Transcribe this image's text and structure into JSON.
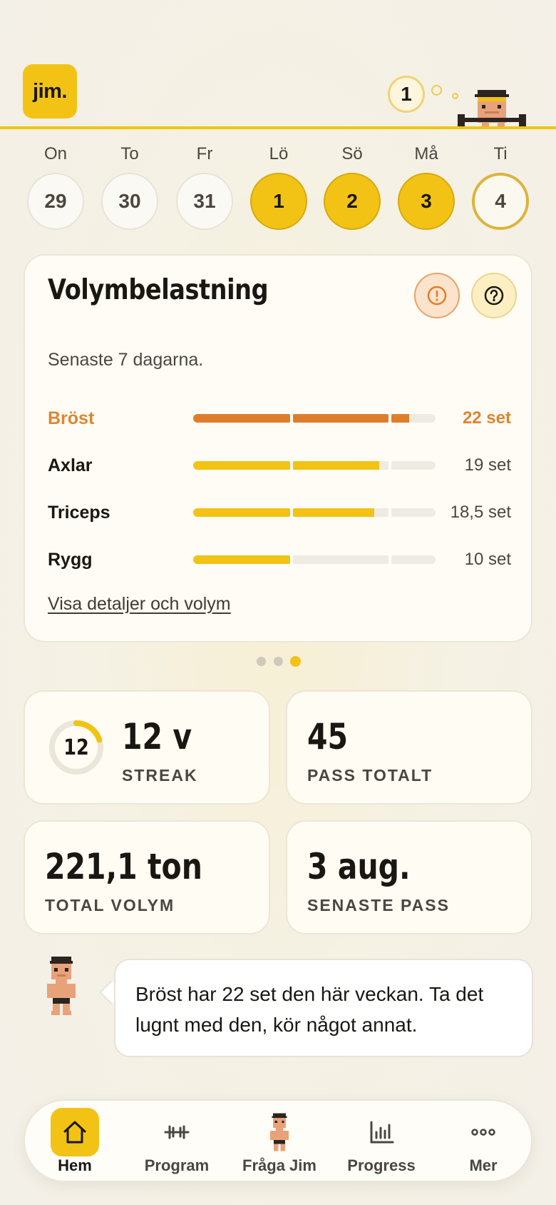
{
  "header": {
    "logo_text": "jim.",
    "notification_count": "1",
    "accent_color": "#f2c314"
  },
  "week": [
    {
      "name": "On",
      "date": "29",
      "state": "none"
    },
    {
      "name": "To",
      "date": "30",
      "state": "none"
    },
    {
      "name": "Fr",
      "date": "31",
      "state": "none"
    },
    {
      "name": "Lö",
      "date": "1",
      "state": "done"
    },
    {
      "name": "Sö",
      "date": "2",
      "state": "done"
    },
    {
      "name": "Må",
      "date": "3",
      "state": "done"
    },
    {
      "name": "Ti",
      "date": "4",
      "state": "today"
    }
  ],
  "volume_card": {
    "title": "Volymbelastning",
    "subtitle": "Senaste 7 dagarna.",
    "warning_icon": "exclamation-circle-icon",
    "help_icon": "question-circle-icon",
    "rows": [
      {
        "label": "Bröst",
        "value": "22 set",
        "sets": 22,
        "status": "over"
      },
      {
        "label": "Axlar",
        "value": "19 set",
        "sets": 19,
        "status": "ok"
      },
      {
        "label": "Triceps",
        "value": "18,5 set",
        "sets": 18.5,
        "status": "ok"
      },
      {
        "label": "Rygg",
        "value": "10 set",
        "sets": 10,
        "status": "ok"
      }
    ],
    "link_text": "Visa detaljer och volym",
    "over_color": "#de7e2c"
  },
  "pager": {
    "count": 3,
    "active_index": 2
  },
  "stats": {
    "streak": {
      "ring_number": "12",
      "value": "12 v",
      "caption": "STREAK",
      "progress": 0.2
    },
    "sessions": {
      "value": "45",
      "caption": "PASS TOTALT"
    },
    "volume": {
      "value": "221,1 ton",
      "caption": "TOTAL VOLYM"
    },
    "last": {
      "value": "3 aug.",
      "caption": "SENASTE PASS"
    }
  },
  "tip": {
    "text": "Bröst har 22 set den här veckan. Ta det lugnt med den, kör något annat."
  },
  "nav": [
    {
      "label": "Hem",
      "icon": "home-icon",
      "active": true
    },
    {
      "label": "Program",
      "icon": "dumbbell-icon",
      "active": false
    },
    {
      "label": "Fråga Jim",
      "icon": "jim-avatar-icon",
      "active": false
    },
    {
      "label": "Progress",
      "icon": "bar-chart-icon",
      "active": false
    },
    {
      "label": "Mer",
      "icon": "more-dots-icon",
      "active": false
    }
  ]
}
